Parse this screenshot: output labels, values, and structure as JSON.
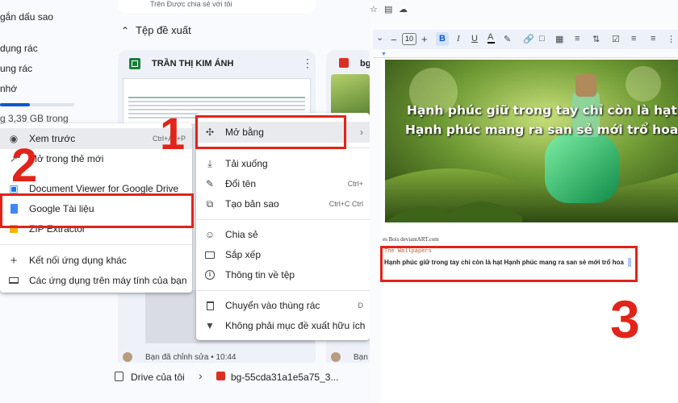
{
  "drive": {
    "sidebar": {
      "starred": "gắn dấu sao",
      "trash": "dụng rác",
      "spam": "ung rác",
      "storage": "nhớ",
      "storage_used": "g 3,39 GB trong"
    },
    "top_card_text": "Trên Được chia sẻ với tôi",
    "suggested_heading": "Tệp đề xuất",
    "file_card_title": "TRẦN THỊ KIM ÁNH",
    "image_card_title": "bg",
    "card_footer": "Bạn đã chỉnh sửa • 10:44",
    "card_footer2": "Bạn đã",
    "breadcrumb": {
      "root": "Drive của tôi",
      "file": "bg-55cda31a1e5a75_3..."
    },
    "open_with_menu": [
      {
        "icon": "eye-icon",
        "label": "Xem trước",
        "shortcut": "Ctrl+Alt+P"
      },
      {
        "icon": "open-in-new-icon",
        "label": "Mở trong thẻ mới",
        "shortcut": ""
      },
      {
        "icon": "doc-viewer-icon",
        "label": "Document Viewer for Google Drive",
        "shortcut": ""
      },
      {
        "icon": "google-docs-icon",
        "label": "Google Tài liệu",
        "shortcut": ""
      },
      {
        "icon": "zip-extractor-icon",
        "label": "ZIP Extractor",
        "shortcut": ""
      },
      {
        "icon": "plus-icon",
        "label": "Kết nối ứng dụng khác",
        "shortcut": ""
      },
      {
        "icon": "laptop-icon",
        "label": "Các ứng dụng trên máy tính của bạn",
        "shortcut": ""
      }
    ],
    "context_menu": [
      {
        "icon": "open-with-icon",
        "label": "Mở bằng",
        "shortcut": ""
      },
      {
        "icon": "download-icon",
        "label": "Tải xuống",
        "shortcut": ""
      },
      {
        "icon": "rename-icon",
        "label": "Đổi tên",
        "shortcut": "Ctrl+"
      },
      {
        "icon": "copy-icon",
        "label": "Tạo bản sao",
        "shortcut": "Ctrl+C Ctrl"
      },
      {
        "icon": "share-icon",
        "label": "Chia sẻ",
        "shortcut": ""
      },
      {
        "icon": "folder-icon",
        "label": "Sắp xếp",
        "shortcut": ""
      },
      {
        "icon": "info-icon",
        "label": "Thông tin về tệp",
        "shortcut": ""
      },
      {
        "icon": "trash-icon",
        "label": "Chuyển vào thùng rác",
        "shortcut": "D"
      },
      {
        "icon": "thumb-down-icon",
        "label": "Không phải mục đề xuất hữu ích",
        "shortcut": ""
      }
    ]
  },
  "docs": {
    "font_size": "10",
    "caption_line1": "Hạnh phúc giữ trong tay chỉ còn là hạt",
    "caption_line2": "Hạnh phúc mang ra san sẻ mới trổ hoa",
    "credit": "es Bois deviantART.com",
    "source_title": "The Wallpapers",
    "extracted_text": "Hạnh phúc giữ trong tay chỉ còn là hạt Hạnh phúc mang ra san sẻ mới trổ hoa"
  },
  "steps": {
    "one": "1",
    "two": "2",
    "three": "3"
  },
  "colors": {
    "highlight": "#e2231a",
    "docs_blue": "#4285f4",
    "sheets_green": "#188038"
  }
}
